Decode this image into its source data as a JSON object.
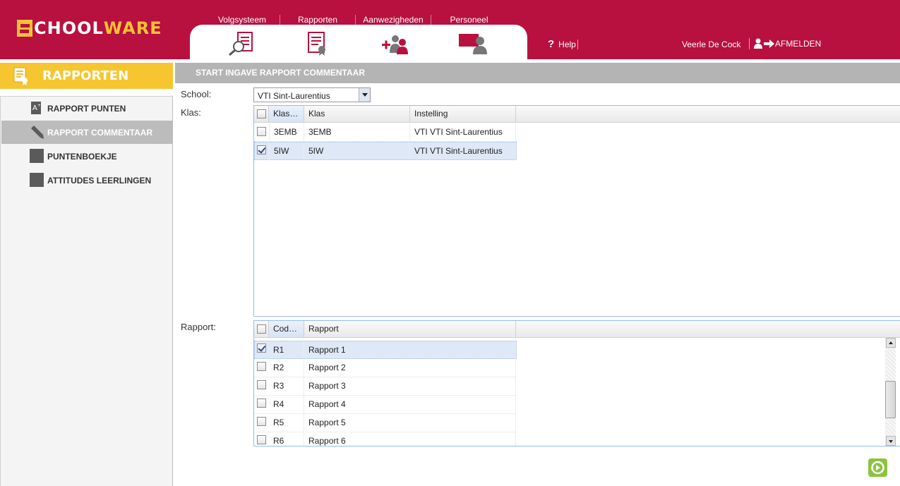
{
  "brand": {
    "logo_part1": "CHOOL",
    "logo_part2": "WARE",
    "brand_color": "#b8103f",
    "accent_color": "#f6c52f"
  },
  "topnav": {
    "items": [
      {
        "label": "Volgsysteem",
        "icon": "search-document-icon"
      },
      {
        "label": "Rapporten",
        "icon": "report-certificate-icon"
      },
      {
        "label": "Aanwezigheden",
        "icon": "add-users-icon"
      },
      {
        "label": "Personeel",
        "icon": "staff-board-icon"
      }
    ],
    "help_label": "Help",
    "user_name": "Veerle De Cock",
    "logout_label": "AFMELDEN"
  },
  "sidebar": {
    "title": "RAPPORTEN",
    "items": [
      {
        "label": "RAPPORT PUNTEN",
        "icon": "grade-sheet-icon",
        "active": false
      },
      {
        "label": "RAPPORT COMMENTAAR",
        "icon": "pencil-icon",
        "active": true
      },
      {
        "label": "PUNTENBOEKJE",
        "icon": "grey-square-icon",
        "active": false
      },
      {
        "label": "ATTITUDES LEERLINGEN",
        "icon": "grey-square-icon",
        "active": false
      }
    ]
  },
  "main": {
    "title": "START INGAVE RAPPORT COMMENTAAR",
    "school_label": "School:",
    "school_value": "VTI Sint-Laurentius",
    "klas_label": "Klas:",
    "rapport_label": "Rapport:",
    "klas_grid": {
      "columns": [
        "Klas…",
        "Klas",
        "Instelling"
      ],
      "rows": [
        {
          "code": "3EMB",
          "klas": "3EMB",
          "instelling": "VTI VTI Sint-Laurentius",
          "checked": false
        },
        {
          "code": "5IW",
          "klas": "5IW",
          "instelling": "VTI VTI Sint-Laurentius",
          "checked": true
        }
      ]
    },
    "rapport_grid": {
      "columns": [
        "Cod…",
        "Rapport"
      ],
      "rows": [
        {
          "code": "R1",
          "name": "Rapport 1",
          "checked": true
        },
        {
          "code": "R2",
          "name": "Rapport 2",
          "checked": false
        },
        {
          "code": "R3",
          "name": "Rapport 3",
          "checked": false
        },
        {
          "code": "R4",
          "name": "Rapport 4",
          "checked": false
        },
        {
          "code": "R5",
          "name": "Rapport 5",
          "checked": false
        },
        {
          "code": "R6",
          "name": "Rapport 6",
          "checked": false
        }
      ]
    }
  }
}
